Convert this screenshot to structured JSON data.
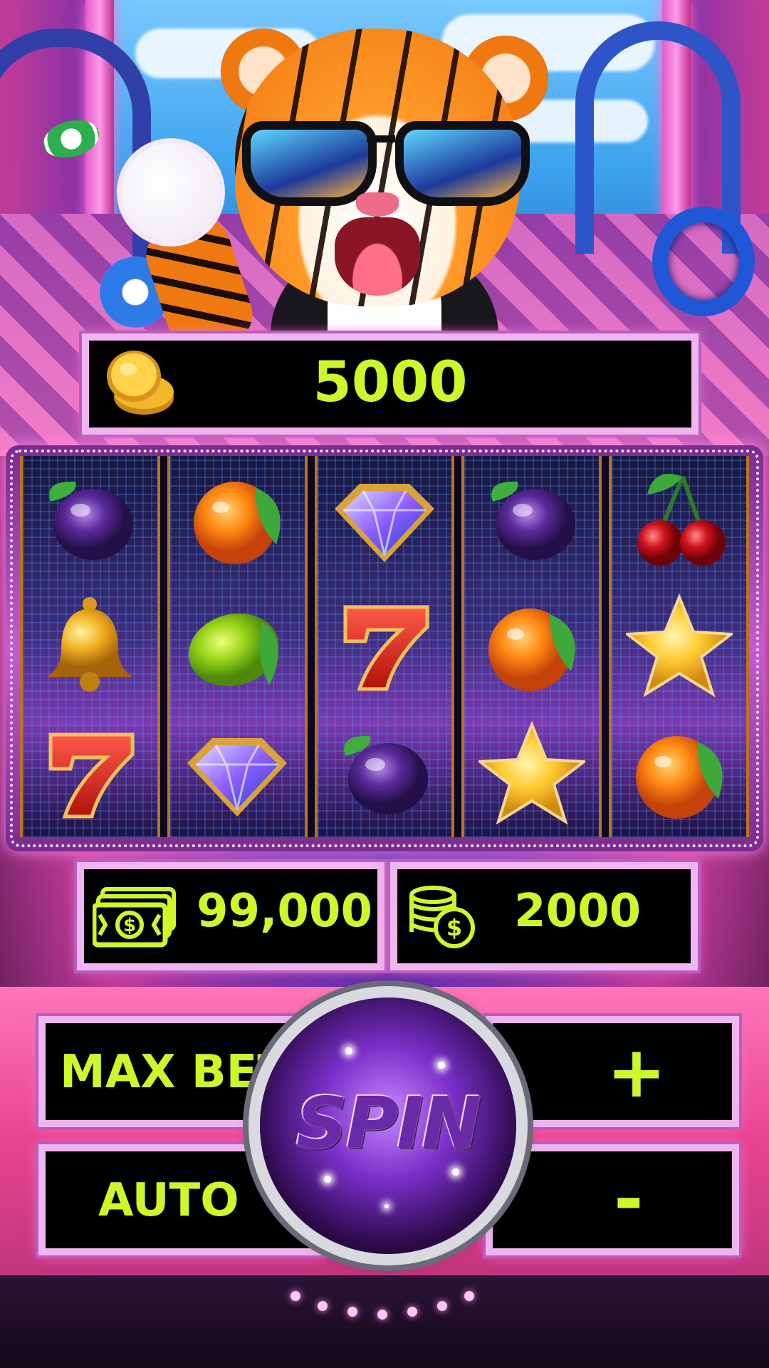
{
  "balance": {
    "icon": "gold-coin-icon",
    "value": "5000"
  },
  "reels": [
    [
      "plum",
      "bell",
      "seven"
    ],
    [
      "orange",
      "lime",
      "diamond"
    ],
    [
      "diamond",
      "seven",
      "plum"
    ],
    [
      "plum",
      "orange",
      "star"
    ],
    [
      "cherry",
      "star",
      "orange"
    ]
  ],
  "stats": {
    "cash_icon": "cash-stack-icon",
    "cash_value": "99,000",
    "bet_icon": "coin-stack-icon",
    "bet_value": "2000"
  },
  "controls": {
    "max_bet_label": "MAX BET",
    "auto_label": "AUTO",
    "plus_label": "+",
    "minus_label": "-",
    "spin_label": "SPIN"
  },
  "colors": {
    "value_text": "#cdf72a",
    "panel_border": "#f0b5ee",
    "accent_pink": "#e8458f",
    "spin_purple": "#7b2fc9"
  }
}
